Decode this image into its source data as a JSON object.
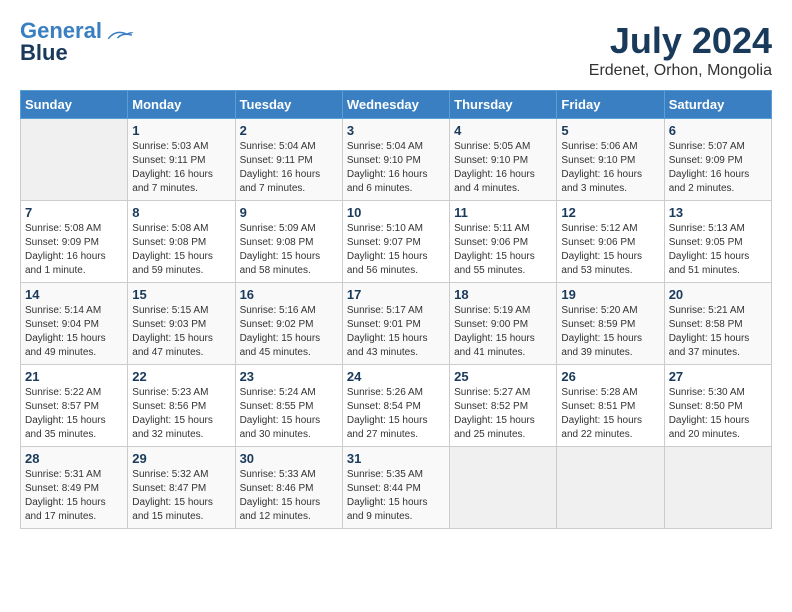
{
  "header": {
    "logo_line1": "General",
    "logo_line2": "Blue",
    "month_year": "July 2024",
    "location": "Erdenet, Orhon, Mongolia"
  },
  "weekdays": [
    "Sunday",
    "Monday",
    "Tuesday",
    "Wednesday",
    "Thursday",
    "Friday",
    "Saturday"
  ],
  "weeks": [
    [
      {
        "day": "",
        "sunrise": "",
        "sunset": "",
        "daylight": ""
      },
      {
        "day": "1",
        "sunrise": "Sunrise: 5:03 AM",
        "sunset": "Sunset: 9:11 PM",
        "daylight": "Daylight: 16 hours and 7 minutes."
      },
      {
        "day": "2",
        "sunrise": "Sunrise: 5:04 AM",
        "sunset": "Sunset: 9:11 PM",
        "daylight": "Daylight: 16 hours and 7 minutes."
      },
      {
        "day": "3",
        "sunrise": "Sunrise: 5:04 AM",
        "sunset": "Sunset: 9:10 PM",
        "daylight": "Daylight: 16 hours and 6 minutes."
      },
      {
        "day": "4",
        "sunrise": "Sunrise: 5:05 AM",
        "sunset": "Sunset: 9:10 PM",
        "daylight": "Daylight: 16 hours and 4 minutes."
      },
      {
        "day": "5",
        "sunrise": "Sunrise: 5:06 AM",
        "sunset": "Sunset: 9:10 PM",
        "daylight": "Daylight: 16 hours and 3 minutes."
      },
      {
        "day": "6",
        "sunrise": "Sunrise: 5:07 AM",
        "sunset": "Sunset: 9:09 PM",
        "daylight": "Daylight: 16 hours and 2 minutes."
      }
    ],
    [
      {
        "day": "7",
        "sunrise": "Sunrise: 5:08 AM",
        "sunset": "Sunset: 9:09 PM",
        "daylight": "Daylight: 16 hours and 1 minute."
      },
      {
        "day": "8",
        "sunrise": "Sunrise: 5:08 AM",
        "sunset": "Sunset: 9:08 PM",
        "daylight": "Daylight: 15 hours and 59 minutes."
      },
      {
        "day": "9",
        "sunrise": "Sunrise: 5:09 AM",
        "sunset": "Sunset: 9:08 PM",
        "daylight": "Daylight: 15 hours and 58 minutes."
      },
      {
        "day": "10",
        "sunrise": "Sunrise: 5:10 AM",
        "sunset": "Sunset: 9:07 PM",
        "daylight": "Daylight: 15 hours and 56 minutes."
      },
      {
        "day": "11",
        "sunrise": "Sunrise: 5:11 AM",
        "sunset": "Sunset: 9:06 PM",
        "daylight": "Daylight: 15 hours and 55 minutes."
      },
      {
        "day": "12",
        "sunrise": "Sunrise: 5:12 AM",
        "sunset": "Sunset: 9:06 PM",
        "daylight": "Daylight: 15 hours and 53 minutes."
      },
      {
        "day": "13",
        "sunrise": "Sunrise: 5:13 AM",
        "sunset": "Sunset: 9:05 PM",
        "daylight": "Daylight: 15 hours and 51 minutes."
      }
    ],
    [
      {
        "day": "14",
        "sunrise": "Sunrise: 5:14 AM",
        "sunset": "Sunset: 9:04 PM",
        "daylight": "Daylight: 15 hours and 49 minutes."
      },
      {
        "day": "15",
        "sunrise": "Sunrise: 5:15 AM",
        "sunset": "Sunset: 9:03 PM",
        "daylight": "Daylight: 15 hours and 47 minutes."
      },
      {
        "day": "16",
        "sunrise": "Sunrise: 5:16 AM",
        "sunset": "Sunset: 9:02 PM",
        "daylight": "Daylight: 15 hours and 45 minutes."
      },
      {
        "day": "17",
        "sunrise": "Sunrise: 5:17 AM",
        "sunset": "Sunset: 9:01 PM",
        "daylight": "Daylight: 15 hours and 43 minutes."
      },
      {
        "day": "18",
        "sunrise": "Sunrise: 5:19 AM",
        "sunset": "Sunset: 9:00 PM",
        "daylight": "Daylight: 15 hours and 41 minutes."
      },
      {
        "day": "19",
        "sunrise": "Sunrise: 5:20 AM",
        "sunset": "Sunset: 8:59 PM",
        "daylight": "Daylight: 15 hours and 39 minutes."
      },
      {
        "day": "20",
        "sunrise": "Sunrise: 5:21 AM",
        "sunset": "Sunset: 8:58 PM",
        "daylight": "Daylight: 15 hours and 37 minutes."
      }
    ],
    [
      {
        "day": "21",
        "sunrise": "Sunrise: 5:22 AM",
        "sunset": "Sunset: 8:57 PM",
        "daylight": "Daylight: 15 hours and 35 minutes."
      },
      {
        "day": "22",
        "sunrise": "Sunrise: 5:23 AM",
        "sunset": "Sunset: 8:56 PM",
        "daylight": "Daylight: 15 hours and 32 minutes."
      },
      {
        "day": "23",
        "sunrise": "Sunrise: 5:24 AM",
        "sunset": "Sunset: 8:55 PM",
        "daylight": "Daylight: 15 hours and 30 minutes."
      },
      {
        "day": "24",
        "sunrise": "Sunrise: 5:26 AM",
        "sunset": "Sunset: 8:54 PM",
        "daylight": "Daylight: 15 hours and 27 minutes."
      },
      {
        "day": "25",
        "sunrise": "Sunrise: 5:27 AM",
        "sunset": "Sunset: 8:52 PM",
        "daylight": "Daylight: 15 hours and 25 minutes."
      },
      {
        "day": "26",
        "sunrise": "Sunrise: 5:28 AM",
        "sunset": "Sunset: 8:51 PM",
        "daylight": "Daylight: 15 hours and 22 minutes."
      },
      {
        "day": "27",
        "sunrise": "Sunrise: 5:30 AM",
        "sunset": "Sunset: 8:50 PM",
        "daylight": "Daylight: 15 hours and 20 minutes."
      }
    ],
    [
      {
        "day": "28",
        "sunrise": "Sunrise: 5:31 AM",
        "sunset": "Sunset: 8:49 PM",
        "daylight": "Daylight: 15 hours and 17 minutes."
      },
      {
        "day": "29",
        "sunrise": "Sunrise: 5:32 AM",
        "sunset": "Sunset: 8:47 PM",
        "daylight": "Daylight: 15 hours and 15 minutes."
      },
      {
        "day": "30",
        "sunrise": "Sunrise: 5:33 AM",
        "sunset": "Sunset: 8:46 PM",
        "daylight": "Daylight: 15 hours and 12 minutes."
      },
      {
        "day": "31",
        "sunrise": "Sunrise: 5:35 AM",
        "sunset": "Sunset: 8:44 PM",
        "daylight": "Daylight: 15 hours and 9 minutes."
      },
      {
        "day": "",
        "sunrise": "",
        "sunset": "",
        "daylight": ""
      },
      {
        "day": "",
        "sunrise": "",
        "sunset": "",
        "daylight": ""
      },
      {
        "day": "",
        "sunrise": "",
        "sunset": "",
        "daylight": ""
      }
    ]
  ]
}
